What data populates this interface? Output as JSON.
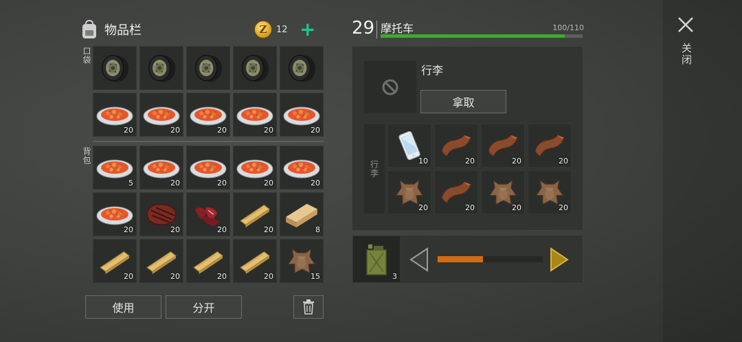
{
  "inventory": {
    "title": "物品栏",
    "coins": "12",
    "coin_symbol": "Z",
    "plus": "+",
    "pockets_label": "口袋",
    "backpack_label": "背包",
    "pockets": [
      {
        "item": "tire",
        "qty": ""
      },
      {
        "item": "tire",
        "qty": ""
      },
      {
        "item": "tire",
        "qty": ""
      },
      {
        "item": "tire",
        "qty": ""
      },
      {
        "item": "tire",
        "qty": ""
      },
      {
        "item": "stew",
        "qty": "20"
      },
      {
        "item": "stew",
        "qty": "20"
      },
      {
        "item": "stew",
        "qty": "20"
      },
      {
        "item": "stew",
        "qty": "20"
      },
      {
        "item": "stew",
        "qty": "20"
      }
    ],
    "backpack": [
      {
        "item": "stew",
        "qty": "5"
      },
      {
        "item": "stew",
        "qty": "20"
      },
      {
        "item": "stew",
        "qty": "20"
      },
      {
        "item": "stew",
        "qty": "20"
      },
      {
        "item": "stew",
        "qty": "20"
      },
      {
        "item": "stew",
        "qty": "20"
      },
      {
        "item": "steak",
        "qty": "20"
      },
      {
        "item": "raw-meat",
        "qty": "20"
      },
      {
        "item": "plank",
        "qty": "20"
      },
      {
        "item": "log",
        "qty": "8"
      },
      {
        "item": "plank",
        "qty": "20"
      },
      {
        "item": "plank",
        "qty": "20"
      },
      {
        "item": "plank",
        "qty": "20"
      },
      {
        "item": "plank",
        "qty": "20"
      },
      {
        "item": "hide",
        "qty": "15"
      }
    ],
    "use_label": "使用",
    "split_label": "分开"
  },
  "vehicle": {
    "level": "29",
    "name": "摩托车",
    "hp_text": "100/110",
    "hp_fraction": 0.91,
    "hp_color": "#3faa2e",
    "luggage_title": "行李",
    "take_label": "拿取",
    "storage_label": "行李",
    "storage": [
      {
        "item": "phone",
        "qty": "10"
      },
      {
        "item": "leather",
        "qty": "20"
      },
      {
        "item": "leather",
        "qty": "20"
      },
      {
        "item": "leather",
        "qty": "20"
      },
      {
        "item": "hide",
        "qty": "20"
      },
      {
        "item": "leather",
        "qty": "20"
      },
      {
        "item": "hide",
        "qty": "20"
      },
      {
        "item": "hide",
        "qty": "20"
      }
    ],
    "fuel_item": "jerry-can",
    "fuel_qty": "3",
    "fuel_fraction": 0.43,
    "fuel_color": "#d46a12"
  },
  "close_label": "关闭"
}
